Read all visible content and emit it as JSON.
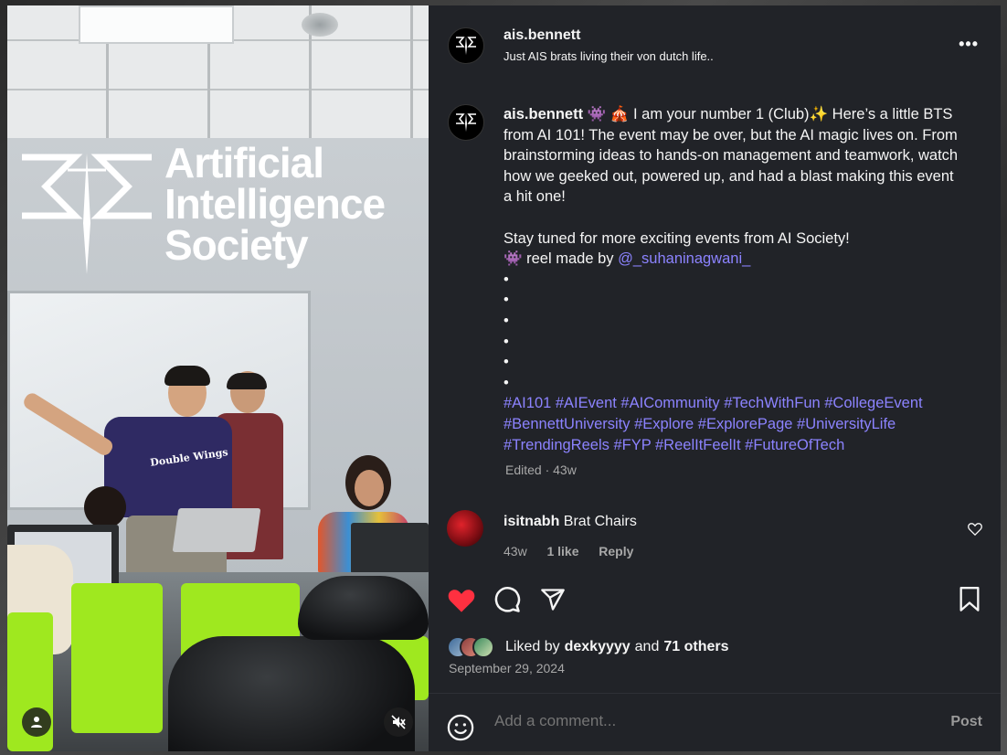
{
  "post": {
    "username": "ais.bennett",
    "subtitle": "Just AIS brats living their von dutch life..",
    "more_label": "•••"
  },
  "media": {
    "overlay_line1": "Artificial",
    "overlay_line2": "Intelligence",
    "overlay_line3": "Society",
    "shirt_text": "Double Wings",
    "user_icon": "user-icon",
    "mute_icon": "speaker-muted-icon"
  },
  "caption": {
    "username": "ais.bennett",
    "emojis_lead": "👾 🎪",
    "text1": "I am your number 1 (Club)✨ Here’s a little BTS from AI 101! The event may be over, but the AI magic lives on. From brainstorming ideas to hands-on management and teamwork, watch how we geeked out, powered up, and had a blast making this event a hit one!",
    "text2": "Stay tuned for more exciting events from AI Society!",
    "reel_prefix": "👾 reel made by",
    "reel_mention": "@_suhaninagwani_",
    "bullets": [
      "•",
      "•",
      "•",
      "•",
      "•",
      "•"
    ],
    "hashtags_line1": "#AI101 #AIEvent #AICommunity #TechWithFun #CollegeEvent",
    "hashtags_line2": "#BennettUniversity #Explore #ExplorePage #UniversityLife",
    "hashtags_line3": "#TrendingReels #FYP #ReelItFeelIt #FutureOfTech",
    "edited": "Edited · 43w"
  },
  "comment": {
    "username": "isitnabh",
    "text": "Brat Chairs",
    "age": "43w",
    "likes": "1 like",
    "reply": "Reply"
  },
  "actions": {
    "like_icon": "heart-filled-icon",
    "comment_icon": "comment-icon",
    "share_icon": "share-icon",
    "save_icon": "bookmark-icon",
    "like_color": "#ff3040"
  },
  "likes": {
    "prefix": "Liked by",
    "user": "dexkyyyy",
    "and": "and",
    "others": "71 others"
  },
  "date": "September 29, 2024",
  "comment_box": {
    "placeholder": "Add a comment...",
    "post_label": "Post",
    "emoji_icon": "emoji-icon"
  }
}
